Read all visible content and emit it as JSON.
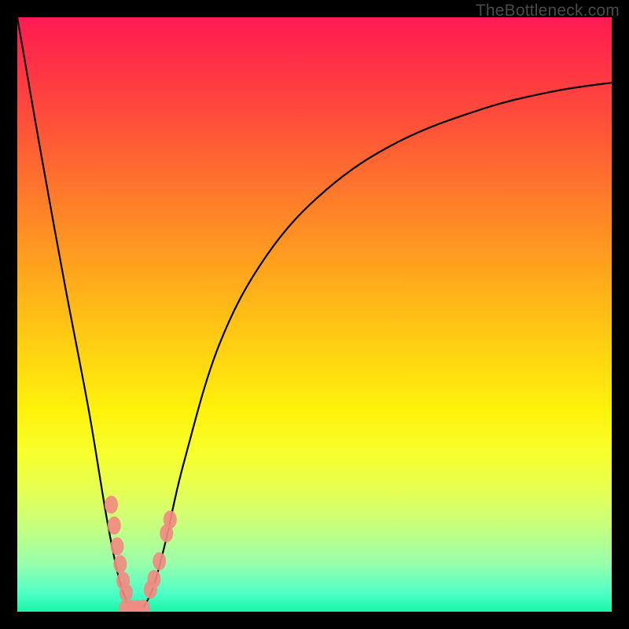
{
  "watermark": "TheBottleneck.com",
  "chart_data": {
    "type": "line",
    "title": "",
    "xlabel": "",
    "ylabel": "",
    "xlim": [
      0,
      100
    ],
    "ylim": [
      0,
      100
    ],
    "grid": false,
    "series": [
      {
        "name": "bottleneck-curve",
        "x": [
          0,
          4,
          8,
          12,
          15,
          17,
          18.5,
          19.3,
          20,
          20.7,
          21.5,
          23,
          25,
          28,
          34,
          42,
          52,
          64,
          78,
          90,
          100
        ],
        "values": [
          100,
          77,
          55,
          34,
          16,
          6,
          1.5,
          0.2,
          0,
          0.2,
          1.2,
          4.5,
          12,
          25,
          45,
          60,
          71,
          79,
          84.5,
          87.5,
          89
        ]
      }
    ],
    "markers": {
      "name": "highlighted-points",
      "color": "#f28b82",
      "points": [
        {
          "x": 15.8,
          "y": 18.0
        },
        {
          "x": 16.3,
          "y": 14.5
        },
        {
          "x": 16.8,
          "y": 11.0
        },
        {
          "x": 17.3,
          "y": 8.0
        },
        {
          "x": 17.8,
          "y": 5.2
        },
        {
          "x": 18.3,
          "y": 3.2
        },
        {
          "x": 18.2,
          "y": 0.5
        },
        {
          "x": 19.2,
          "y": 0.5
        },
        {
          "x": 20.2,
          "y": 0.5
        },
        {
          "x": 21.2,
          "y": 0.5
        },
        {
          "x": 22.4,
          "y": 3.7
        },
        {
          "x": 23.0,
          "y": 5.5
        },
        {
          "x": 23.9,
          "y": 8.5
        },
        {
          "x": 25.1,
          "y": 13.2
        },
        {
          "x": 25.7,
          "y": 15.5
        }
      ]
    }
  }
}
